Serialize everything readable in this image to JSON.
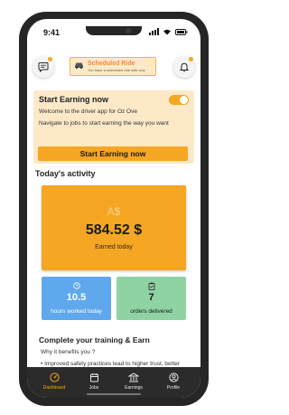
{
  "status_bar": {
    "time": "9:41"
  },
  "header": {
    "scheduled_title": "Scheduled Ride",
    "scheduled_subtitle": "You have a scheduled ride with Ivey"
  },
  "start_card": {
    "title": "Start Earning now",
    "welcome": "Welcome to the driver app for Oz Ove",
    "instruction": "Navigate to jobs to start earning the way you want",
    "button_label": "Start Earning now",
    "toggle_on": true
  },
  "activity": {
    "section_title": "Today's activity",
    "currency_symbol": "A$",
    "amount": "584.52 $",
    "earned_label": "Earned today",
    "hours_value": "10.5",
    "hours_label": "hours worked today",
    "orders_value": "7",
    "orders_label": "orders delivered"
  },
  "training": {
    "title": "Complete your training & Earn",
    "question": "Why it benefits you ?",
    "bullet": "Improved safety practices lead to higher trust, better ratings, and increased bookings."
  },
  "tabs": [
    {
      "label": "Dashboard",
      "icon": "dashboard-icon",
      "active": true
    },
    {
      "label": "Jobs",
      "icon": "jobs-icon",
      "active": false
    },
    {
      "label": "Earnings",
      "icon": "earnings-icon",
      "active": false
    },
    {
      "label": "Profile",
      "icon": "profile-icon",
      "active": false
    }
  ],
  "colors": {
    "accent": "#f5a623",
    "card_bg": "#fde9c8",
    "hours_card": "#5fa8ee",
    "orders_card": "#8fd3a3",
    "tab_bar": "#2b2b2b"
  }
}
